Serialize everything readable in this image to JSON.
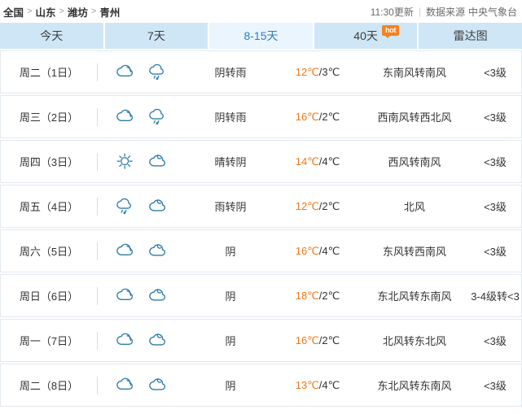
{
  "header": {
    "breadcrumb": {
      "items": [
        "全国",
        "山东",
        "潍坊",
        "青州"
      ],
      "separator": ">"
    },
    "update_time": "11:30更新",
    "divider": "|",
    "source_label": "数据来源",
    "source_name": "中央气象台"
  },
  "tabs": [
    {
      "label": "今天",
      "active": false,
      "badge": null
    },
    {
      "label": "7天",
      "active": false,
      "badge": null
    },
    {
      "label": "8-15天",
      "active": true,
      "badge": null
    },
    {
      "label": "40天",
      "active": false,
      "badge": "hot"
    },
    {
      "label": "雷达图",
      "active": false,
      "badge": null
    }
  ],
  "colors": {
    "tab_bg": "#cfe6f7",
    "tab_active_bg": "#eaf5fd",
    "tab_active_text": "#2b7fc4",
    "high_temp": "#f07818",
    "badge_orange": "#f7821b",
    "icon_blue": "#2e7cab",
    "row_border": "#e3e9ef"
  },
  "forecast": {
    "rows": [
      {
        "date": "周二（1日）",
        "icons": [
          "cloudy-icon",
          "rain-icon"
        ],
        "desc": "阴转雨",
        "high": "12℃",
        "sep": "/",
        "low": "3℃",
        "wind": "东南风转南风",
        "level": "<3级"
      },
      {
        "date": "周三（2日）",
        "icons": [
          "cloudy-icon",
          "rain-icon"
        ],
        "desc": "阴转雨",
        "high": "16℃",
        "sep": "/",
        "low": "2℃",
        "wind": "西南风转西北风",
        "level": "<3级"
      },
      {
        "date": "周四（3日）",
        "icons": [
          "sunny-icon",
          "cloud-night-icon"
        ],
        "desc": "晴转阴",
        "high": "14℃",
        "sep": "/",
        "low": "4℃",
        "wind": "西风转南风",
        "level": "<3级"
      },
      {
        "date": "周五（4日）",
        "icons": [
          "rain-icon",
          "cloud-night-icon"
        ],
        "desc": "雨转阴",
        "high": "12℃",
        "sep": "/",
        "low": "2℃",
        "wind": "北风",
        "level": "<3级"
      },
      {
        "date": "周六（5日）",
        "icons": [
          "cloudy-icon",
          "cloud-night-icon"
        ],
        "desc": "阴",
        "high": "16℃",
        "sep": "/",
        "low": "4℃",
        "wind": "东风转西南风",
        "level": "<3级"
      },
      {
        "date": "周日（6日）",
        "icons": [
          "cloudy-icon",
          "cloud-night-icon"
        ],
        "desc": "阴",
        "high": "18℃",
        "sep": "/",
        "low": "2℃",
        "wind": "东北风转东南风",
        "level": "3-4级转<3"
      },
      {
        "date": "周一（7日）",
        "icons": [
          "cloudy-icon",
          "cloud-night-icon"
        ],
        "desc": "阴",
        "high": "16℃",
        "sep": "/",
        "low": "2℃",
        "wind": "北风转东北风",
        "level": "<3级"
      },
      {
        "date": "周二（8日）",
        "icons": [
          "cloudy-icon",
          "cloud-night-icon"
        ],
        "desc": "阴",
        "high": "13℃",
        "sep": "/",
        "low": "4℃",
        "wind": "东北风转东南风",
        "level": "<3级"
      }
    ]
  }
}
